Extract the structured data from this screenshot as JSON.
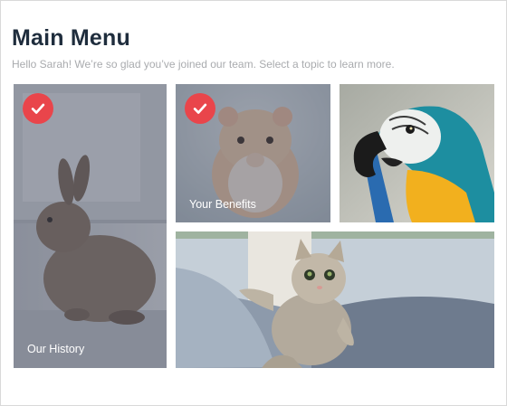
{
  "page": {
    "title": "Main Menu",
    "subtitle": "Hello Sarah! We’re so glad you’ve joined our team. Select a topic to learn more."
  },
  "tiles": [
    {
      "label": "Our History",
      "completed": true,
      "image": "rabbit-photo"
    },
    {
      "label": "Your Benefits",
      "completed": true,
      "image": "hamster-photo"
    },
    {
      "label": "",
      "completed": false,
      "image": "parrot-photo"
    },
    {
      "label": "",
      "completed": false,
      "image": "kitten-photo"
    }
  ],
  "icons": {
    "completed": "checkmark-icon"
  },
  "colors": {
    "title": "#1f2d3d",
    "subtitle": "#a9abae",
    "check_badge": "#e9454b",
    "overlay": "#3d4558"
  }
}
